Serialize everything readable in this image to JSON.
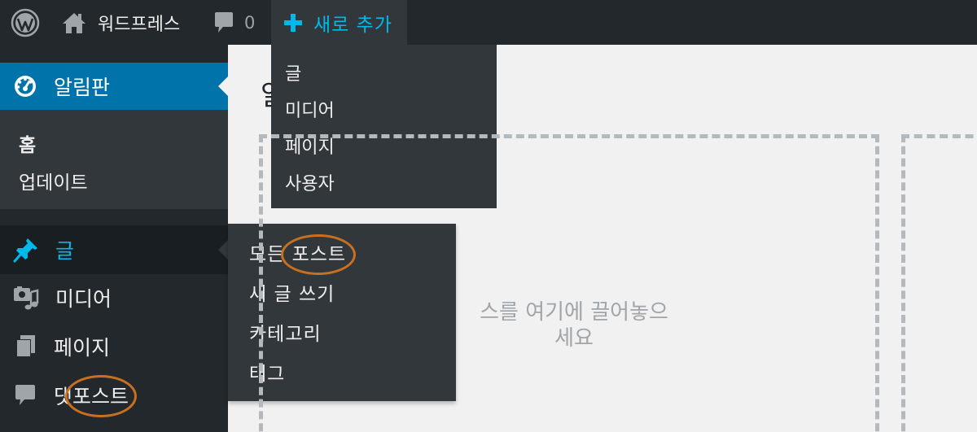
{
  "admin_bar": {
    "site_name": "워드프레스",
    "comments_count": "0",
    "new_label": "새로 추가",
    "new_menu": [
      "글",
      "미디어",
      "페이지",
      "사용자"
    ]
  },
  "admin_menu": {
    "dashboard": "알림판",
    "dashboard_sub": {
      "home": "홈",
      "updates": "업데이트"
    },
    "posts": "글",
    "media": "미디어",
    "pages": "페이지",
    "comments": "댓포스트"
  },
  "posts_flyout": [
    "모든 포스트",
    "새 글 쓰기",
    "카테고리",
    "태그"
  ],
  "content": {
    "title_partial": "알",
    "dropzone_text": "스를 여기에 끌어놓으\n세요"
  },
  "colors": {
    "admin_bg": "#23282d",
    "submenu_bg": "#32373c",
    "accent": "#0073aa",
    "highlight": "#00b9eb",
    "annotation": "#c8701e"
  },
  "icons": {
    "wp": "wordpress-logo-icon",
    "site": "home-icon",
    "comments": "speech-bubble-icon",
    "new": "plus-icon",
    "dashboard": "dashboard-gauge-icon",
    "posts": "pushpin-icon",
    "media": "media-icon",
    "pages": "pages-icon",
    "comment_menu": "comment-bubble-icon"
  }
}
